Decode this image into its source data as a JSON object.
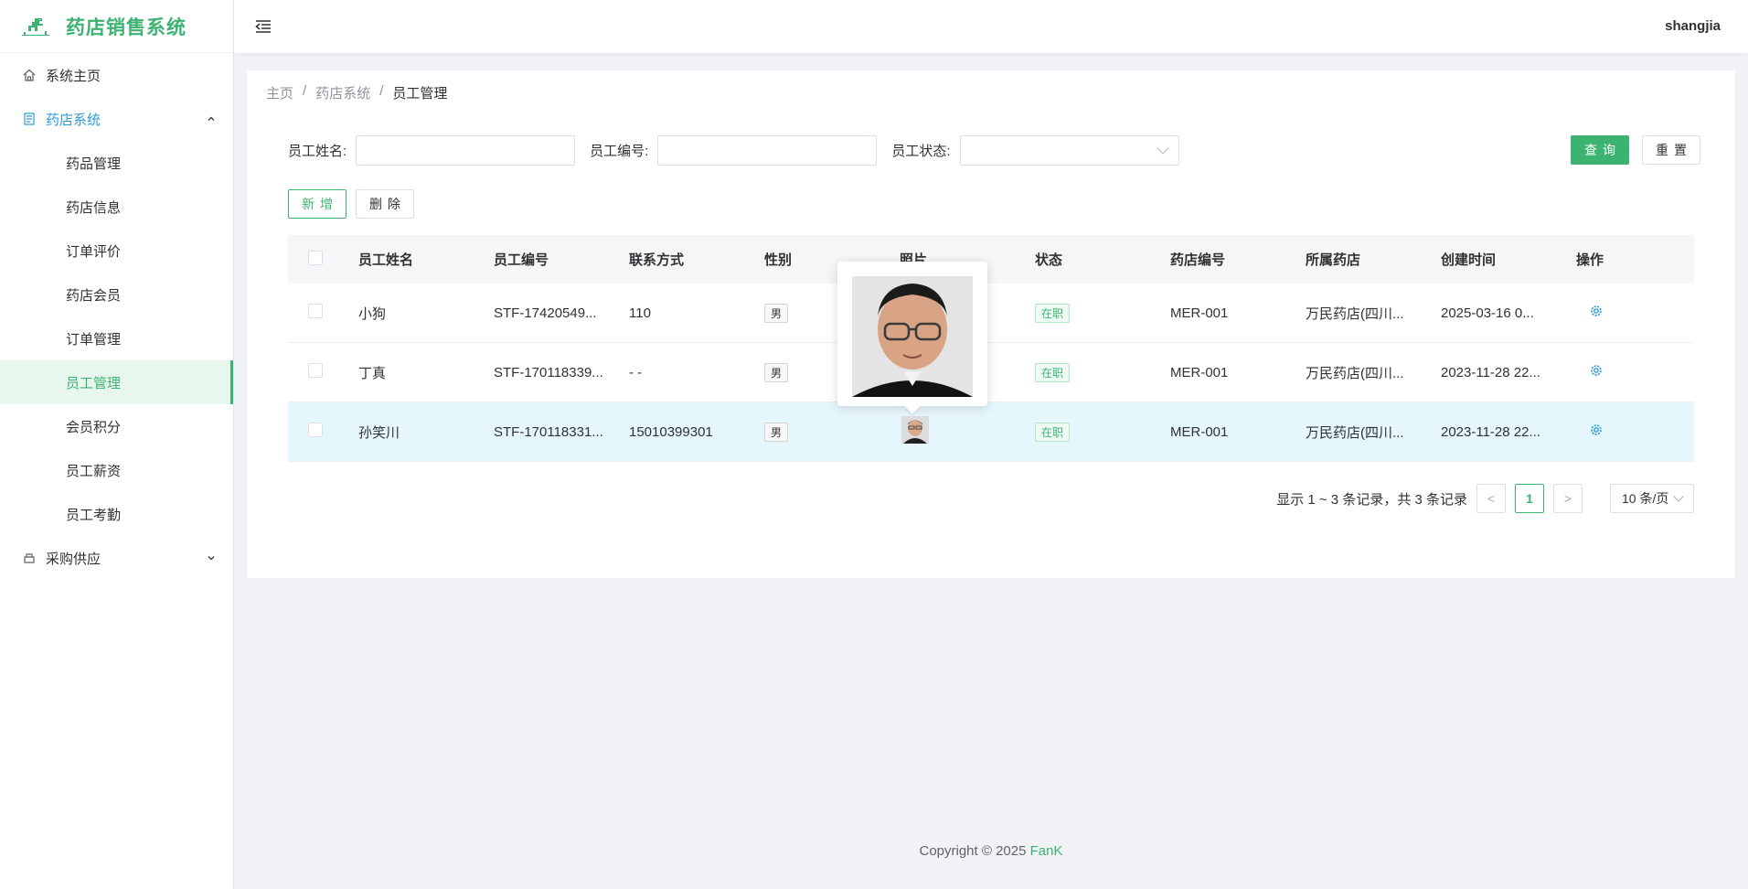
{
  "app": {
    "title": "药店销售系统"
  },
  "header": {
    "user": "shangjia"
  },
  "sidebar": {
    "items": [
      {
        "label": "系统主页",
        "icon": "home-icon"
      },
      {
        "label": "药店系统",
        "icon": "document-icon",
        "expanded": true,
        "children": [
          "药品管理",
          "药店信息",
          "订单评价",
          "药店会员",
          "订单管理",
          "员工管理",
          "会员积分",
          "员工薪资",
          "员工考勤"
        ],
        "active_child": "员工管理"
      },
      {
        "label": "采购供应",
        "icon": "basket-icon",
        "expanded": false
      }
    ]
  },
  "breadcrumb": [
    "主页",
    "药店系统",
    "员工管理"
  ],
  "breadcrumb_sep": "/",
  "filters": {
    "name_label": "员工姓名:",
    "no_label": "员工编号:",
    "status_label": "员工状态:",
    "name_value": "",
    "no_value": "",
    "status_value": ""
  },
  "buttons": {
    "query": "查询",
    "reset": "重置",
    "add": "新增",
    "delete": "删除"
  },
  "table": {
    "columns": [
      "员工姓名",
      "员工编号",
      "联系方式",
      "性别",
      "照片",
      "状态",
      "药店编号",
      "所属药店",
      "创建时间",
      "操作"
    ],
    "rows": [
      {
        "name": "小狗",
        "no": "STF-17420549...",
        "phone": "110",
        "sex": "男",
        "status": "在职",
        "shop_no": "MER-001",
        "shop": "万民药店(四川...",
        "created": "2025-03-16 0..."
      },
      {
        "name": "丁真",
        "no": "STF-170118339...",
        "phone": "- -",
        "sex": "男",
        "status": "在职",
        "shop_no": "MER-001",
        "shop": "万民药店(四川...",
        "created": "2023-11-28 22..."
      },
      {
        "name": "孙笑川",
        "no": "STF-170118331...",
        "phone": "15010399301",
        "sex": "男",
        "status": "在职",
        "shop_no": "MER-001",
        "shop": "万民药店(四川...",
        "created": "2023-11-28 22..."
      }
    ]
  },
  "pagination": {
    "info": "显示 1 ~ 3 条记录，共 3 条记录",
    "current": "1",
    "page_size": "10 条/页",
    "prev": "<",
    "next": ">"
  },
  "footer": {
    "text": "Copyright © 2025 ",
    "brand": "FanK"
  },
  "colors": {
    "primary": "#3cb371",
    "link": "#2f9bd6",
    "row_highlight": "#e6f6fd"
  }
}
